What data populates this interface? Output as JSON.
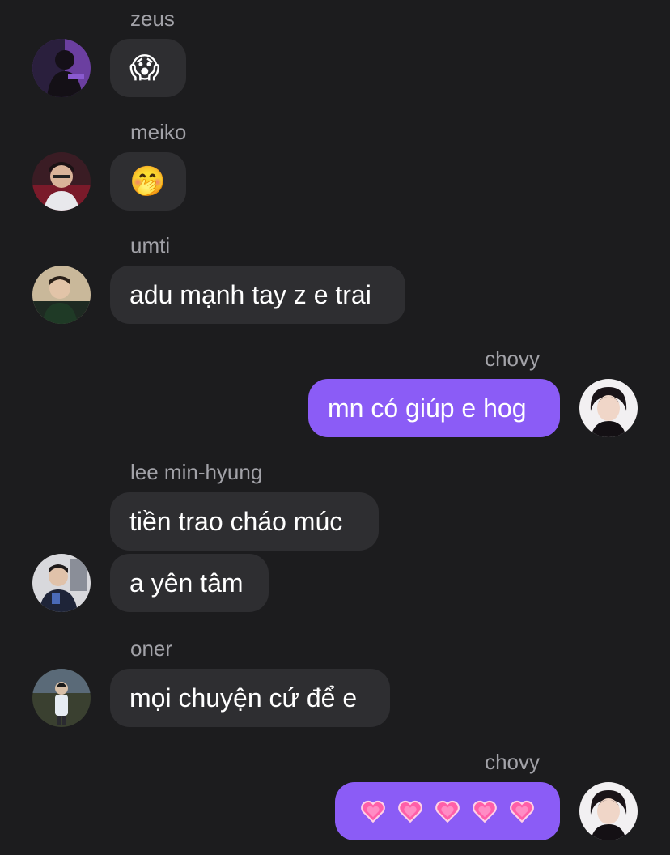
{
  "messages": [
    {
      "sender": "zeus",
      "text": "😱"
    },
    {
      "sender": "meiko",
      "text": "🤭"
    },
    {
      "sender": "umti",
      "text": "adu mạnh tay z e trai"
    },
    {
      "sender": "chovy",
      "text": "mn có giúp e hog"
    },
    {
      "sender": "lee min-hyung",
      "texts": [
        "tiền trao cháo múc",
        "a yên tâm"
      ]
    },
    {
      "sender": "oner",
      "text": "mọi chuyện cứ để e"
    },
    {
      "sender": "chovy",
      "hearts": [
        "growing-heart-emoji",
        "growing-heart-emoji",
        "growing-heart-emoji",
        "growing-heart-emoji",
        "growing-heart-emoji"
      ]
    }
  ],
  "colors": {
    "background": "#1c1c1e",
    "incoming_bubble": "#2e2e31",
    "outgoing_bubble": "#8b5cf6",
    "sender_name": "#a2a2a8",
    "heart": "#ff5fa8"
  }
}
